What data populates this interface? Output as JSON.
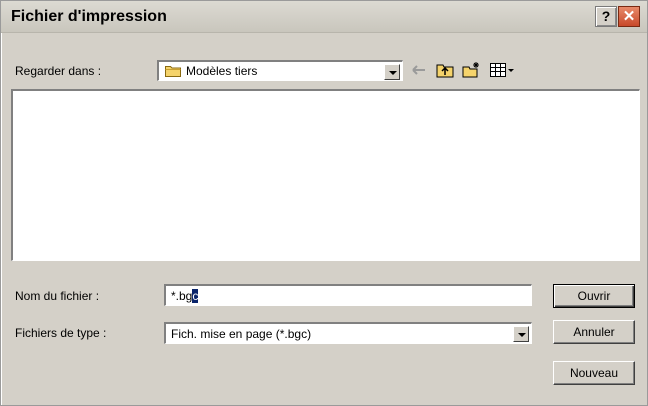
{
  "window": {
    "title": "Fichier d'impression",
    "help_label": "?",
    "close_label": "✕"
  },
  "lookin": {
    "label": "Regarder dans :",
    "value": "Modèles tiers"
  },
  "toolbar": {
    "back_icon": "back-arrow-icon",
    "up_icon": "up-folder-icon",
    "new_icon": "new-folder-icon",
    "view_icon": "view-menu-icon"
  },
  "filename": {
    "label": "Nom du fichier :",
    "value": "*.bgc",
    "selected_part": "c"
  },
  "filetype": {
    "label": "Fichiers de type :",
    "value": "Fich. mise en page (*.bgc)"
  },
  "buttons": {
    "open": "Ouvrir",
    "cancel": "Annuler",
    "new": "Nouveau"
  }
}
